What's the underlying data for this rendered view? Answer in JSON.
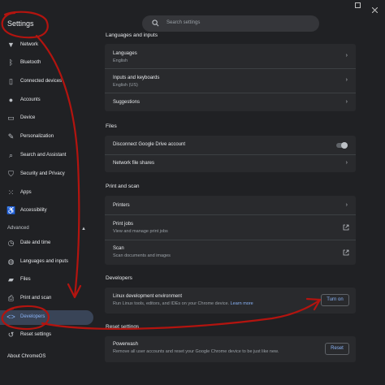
{
  "header": {
    "title": "Settings",
    "search_placeholder": "Search settings"
  },
  "sidebar": {
    "items": [
      {
        "label": "Network",
        "icon": "wifi-icon"
      },
      {
        "label": "Bluetooth",
        "icon": "bluetooth-icon"
      },
      {
        "label": "Connected devices",
        "icon": "phone-icon"
      },
      {
        "label": "Accounts",
        "icon": "person-icon"
      },
      {
        "label": "Device",
        "icon": "laptop-icon"
      },
      {
        "label": "Personalization",
        "icon": "brush-icon"
      },
      {
        "label": "Search and Assistant",
        "icon": "search-icon"
      },
      {
        "label": "Security and Privacy",
        "icon": "shield-icon"
      },
      {
        "label": "Apps",
        "icon": "apps-grid-icon"
      },
      {
        "label": "Accessibility",
        "icon": "accessibility-icon"
      }
    ],
    "advanced_label": "Advanced",
    "advanced_items": [
      {
        "label": "Date and time",
        "icon": "clock-icon"
      },
      {
        "label": "Languages and inputs",
        "icon": "globe-icon"
      },
      {
        "label": "Files",
        "icon": "folder-icon"
      },
      {
        "label": "Print and scan",
        "icon": "printer-icon"
      },
      {
        "label": "Developers",
        "icon": "code-icon",
        "active": true
      },
      {
        "label": "Reset settings",
        "icon": "reset-icon"
      }
    ],
    "about_label": "About ChromeOS"
  },
  "sections": {
    "languages": {
      "title": "Languages and inputs",
      "rows": [
        {
          "title": "Languages",
          "subtitle": "English"
        },
        {
          "title": "Inputs and keyboards",
          "subtitle": "English (US)"
        },
        {
          "title": "Suggestions"
        }
      ]
    },
    "files": {
      "title": "Files",
      "rows": [
        {
          "title": "Disconnect Google Drive account",
          "toggle": false
        },
        {
          "title": "Network file shares"
        }
      ]
    },
    "print": {
      "title": "Print and scan",
      "rows": [
        {
          "title": "Printers"
        },
        {
          "title": "Print jobs",
          "subtitle": "View and manage print jobs"
        },
        {
          "title": "Scan",
          "subtitle": "Scan documents and images"
        }
      ]
    },
    "developers": {
      "title": "Developers",
      "row": {
        "title": "Linux development environment",
        "subtitle": "Run Linux tools, editors, and IDEs on your Chrome device.",
        "link": "Learn more",
        "button": "Turn on"
      }
    },
    "reset": {
      "title": "Reset settings",
      "row": {
        "title": "Powerwash",
        "subtitle": "Remove all user accounts and reset your Google Chrome device to be just like new.",
        "button": "Reset"
      }
    }
  },
  "colors": {
    "background": "#202124",
    "card": "#292a2d",
    "accent": "#8ab4f8",
    "active_bg": "#394457",
    "annotation": "#b3140f"
  }
}
